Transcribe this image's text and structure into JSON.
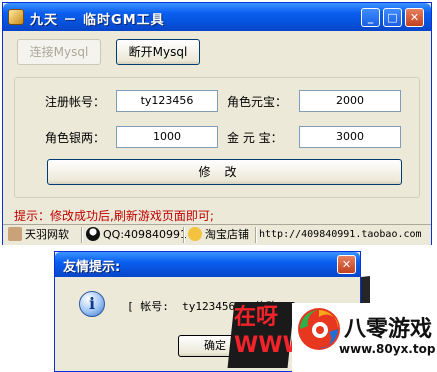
{
  "window": {
    "title": "九天 － 临时GM工具",
    "controls": {
      "minimize": "_",
      "maximize": "□",
      "close": "✕"
    }
  },
  "toolbar": {
    "connect_label": "连接Mysql",
    "disconnect_label": "断开Mysql"
  },
  "form": {
    "account_label": "注册帐号：",
    "account_value": "ty123456",
    "yuanbao_label": "角色元宝：",
    "yuanbao_value": "2000",
    "silver_label": "角色银两：",
    "silver_value": "1000",
    "gold_label": "金 元 宝：",
    "gold_value": "3000",
    "modify_label": "修改"
  },
  "hint": "提示：修改成功后,刷新游戏页面即可;",
  "statusbar": {
    "studio": "天羽网软",
    "qq": "QQ:409840991",
    "shop": "淘宝店铺",
    "url": "http://409840991.taobao.com"
  },
  "dialog": {
    "title": "友情提示:",
    "message": "[ 帐号:  ty123456 ] 修改",
    "ok_label": "确定",
    "close": "✕"
  },
  "watermark": {
    "red_text_1": "在呀",
    "red_text_2": "WWW",
    "brand": "八零游戏",
    "url": "www.80yx.top"
  },
  "colors": {
    "titlebar": "#0a5ff0",
    "face": "#ece9d8",
    "hint": "#c00000",
    "watermark_red": "#f2232a"
  }
}
